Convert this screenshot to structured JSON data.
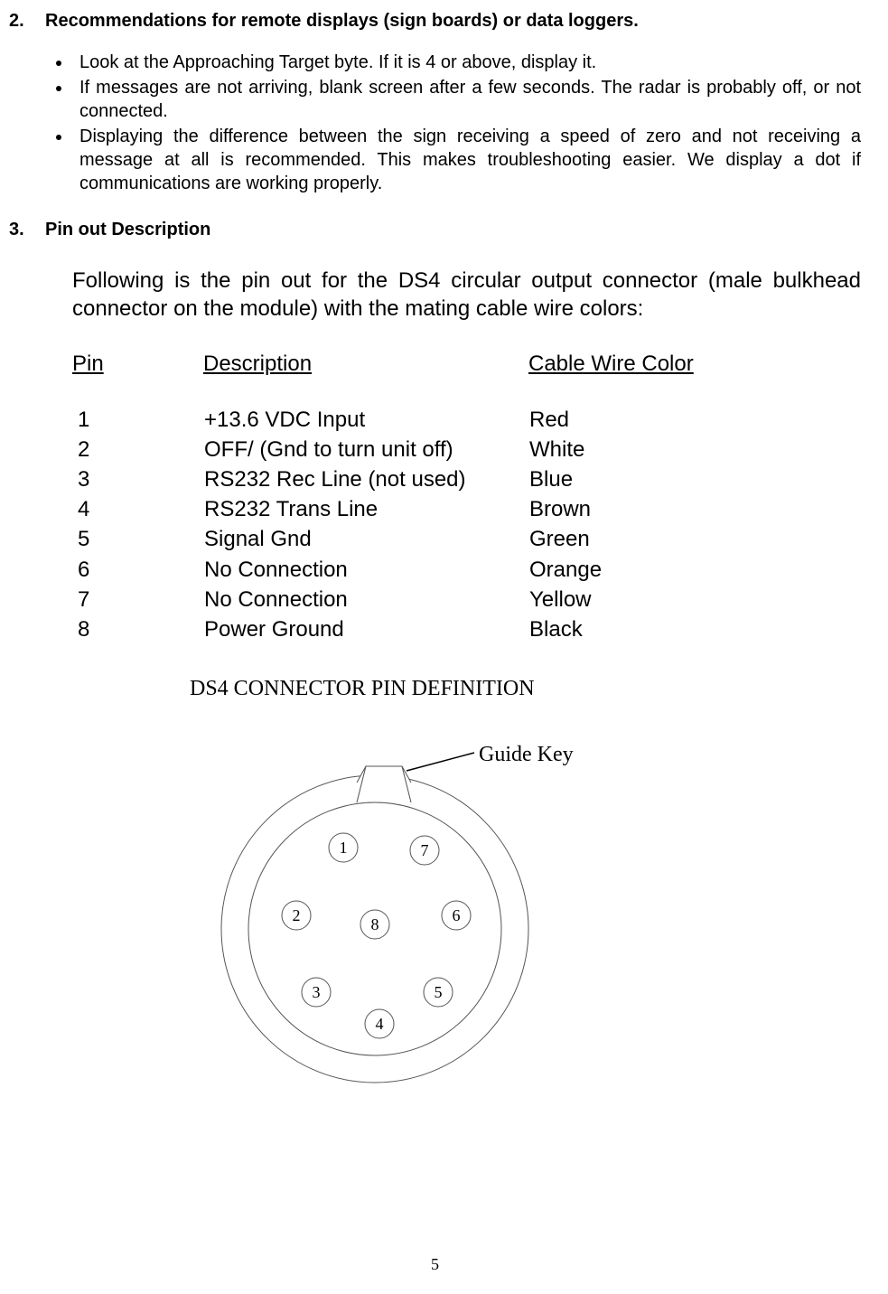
{
  "section2": {
    "num": "2.",
    "title": "Recommendations for remote displays (sign boards) or data loggers.",
    "bullets": [
      "Look at the  Approaching Target byte. If it is 4 or above, display it.",
      "If messages are not arriving, blank screen after a few seconds.  The radar is probably off, or not connected.",
      "Displaying the difference between the sign receiving a speed of zero and not receiving a message at all is recommended.  This makes troubleshooting easier.  We display a dot if communications are working properly."
    ]
  },
  "section3": {
    "num": "3.",
    "title": "Pin out Description",
    "intro": "Following is the pin out for the DS4 circular output connector (male bulkhead connector on the module) with the mating cable wire colors:",
    "headers": {
      "pin": "Pin",
      "desc": "Description",
      "color": "Cable Wire Color"
    },
    "rows": [
      {
        "pin": "1",
        "desc": "+13.6 VDC Input",
        "color": "Red"
      },
      {
        "pin": "2",
        "desc": "OFF/  (Gnd to turn unit off)",
        "color": "White"
      },
      {
        "pin": "3",
        "desc": "RS232 Rec Line (not used)",
        "color": "Blue"
      },
      {
        "pin": "4",
        "desc": "RS232 Trans Line",
        "color": "Brown"
      },
      {
        "pin": "5",
        "desc": "Signal Gnd",
        "color": "Green"
      },
      {
        "pin": "6",
        "desc": "No Connection",
        "color": "Orange"
      },
      {
        "pin": "7",
        "desc": "No Connection",
        "color": "Yellow"
      },
      {
        "pin": "8",
        "desc": "Power Ground",
        "color": "Black"
      }
    ]
  },
  "diagram": {
    "title": "DS4 CONNECTOR PIN DEFINITION",
    "guide_label": "Guide Key",
    "pins": [
      "1",
      "2",
      "3",
      "4",
      "5",
      "6",
      "7",
      "8"
    ]
  },
  "page_number": "5"
}
